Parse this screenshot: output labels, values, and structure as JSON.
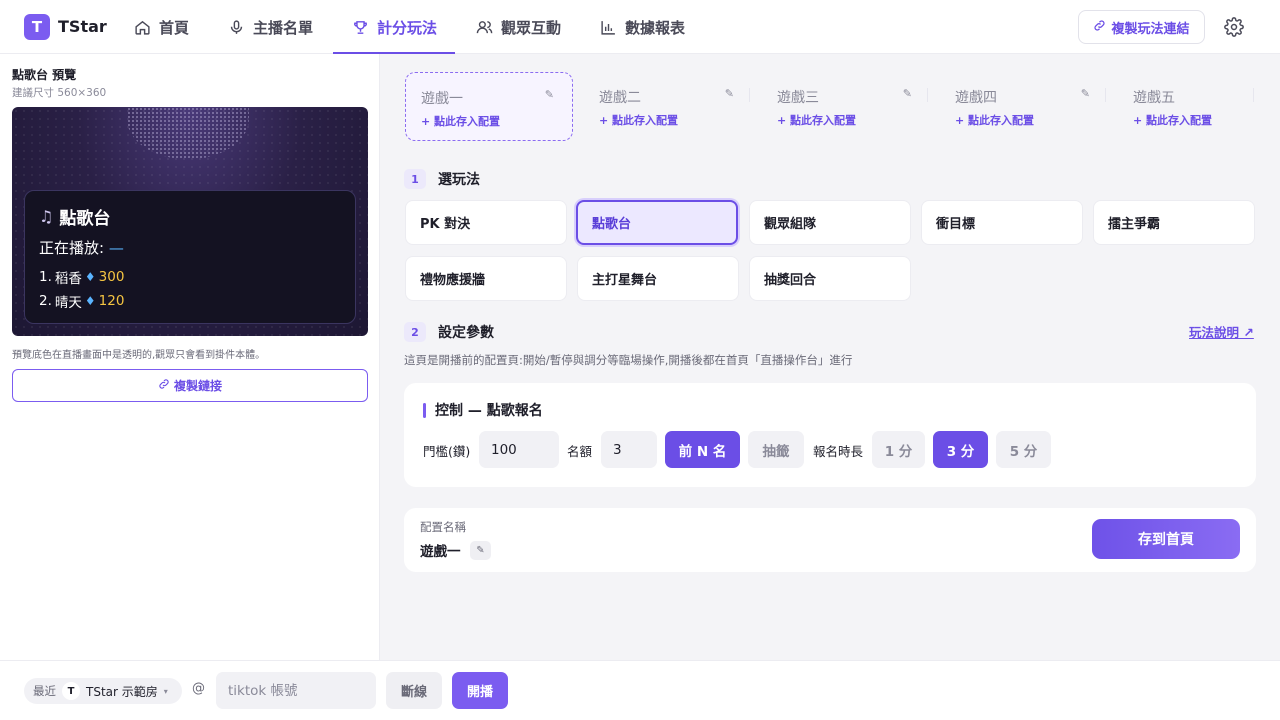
{
  "app": {
    "logo_letter": "T",
    "brand": "TStar"
  },
  "nav": {
    "items": [
      {
        "label": "首頁"
      },
      {
        "label": "主播名單"
      },
      {
        "label": "計分玩法"
      },
      {
        "label": "觀眾互動"
      },
      {
        "label": "數據報表"
      }
    ],
    "copy_link": "複製玩法連結"
  },
  "preview": {
    "title": "點歌台 預覽",
    "size_hint": "建議尺寸 560×360",
    "widget_title": "點歌台",
    "playing_label": "正在播放:",
    "playing_value": "—",
    "queue": [
      {
        "rank": "1.",
        "song": "稻香",
        "gems": "300"
      },
      {
        "rank": "2.",
        "song": "晴天",
        "gems": "120"
      }
    ],
    "note": "預覽底色在直播畫面中是透明的,觀眾只會看到掛件本體。",
    "copy_button": "複製鏈接"
  },
  "slots": {
    "items": [
      {
        "name": "遊戲一",
        "save": "+ 點此存入配置"
      },
      {
        "name": "遊戲二",
        "save": "+ 點此存入配置"
      },
      {
        "name": "遊戲三",
        "save": "+ 點此存入配置"
      },
      {
        "name": "遊戲四",
        "save": "+ 點此存入配置"
      },
      {
        "name": "遊戲五",
        "save": "+ 點此存入配置"
      }
    ]
  },
  "step1": {
    "num": "1",
    "label": "選玩法",
    "modes": [
      "PK 對決",
      "點歌台",
      "觀眾組隊",
      "衝目標",
      "擂主爭霸",
      "禮物應援牆",
      "主打星舞台",
      "抽獎回合"
    ],
    "selected": "點歌台"
  },
  "step2": {
    "num": "2",
    "label": "設定參數",
    "guide_link": "玩法說明 ↗",
    "hint": "這頁是開播前的配置頁:開始/暫停與調分等臨場操作,開播後都在首頁「直播操作台」進行"
  },
  "control": {
    "title": "控制 — 點歌報名",
    "threshold_label": "門檻(鑽)",
    "threshold_value": "100",
    "quota_label": "名額",
    "quota_value": "3",
    "mode_top_n": "前 N 名",
    "mode_draw": "抽籤",
    "duration_label": "報名時長",
    "durations": [
      "1 分",
      "3 分",
      "5 分"
    ],
    "selected_duration": "3 分"
  },
  "save": {
    "config_label": "配置名稱",
    "config_name": "遊戲一",
    "save_button": "存到首頁"
  },
  "bottom": {
    "recent_label": "最近",
    "room_avatar": "T",
    "room_name": "TStar 示範房",
    "at": "@",
    "tiktok_placeholder": "tiktok 帳號",
    "disconnect": "斷線",
    "go_live": "開播"
  },
  "colors": {
    "accent": "#6b4ee6",
    "accent_light": "#ece8ff",
    "gem": "#5ab4ff",
    "gold": "#f5c542"
  }
}
